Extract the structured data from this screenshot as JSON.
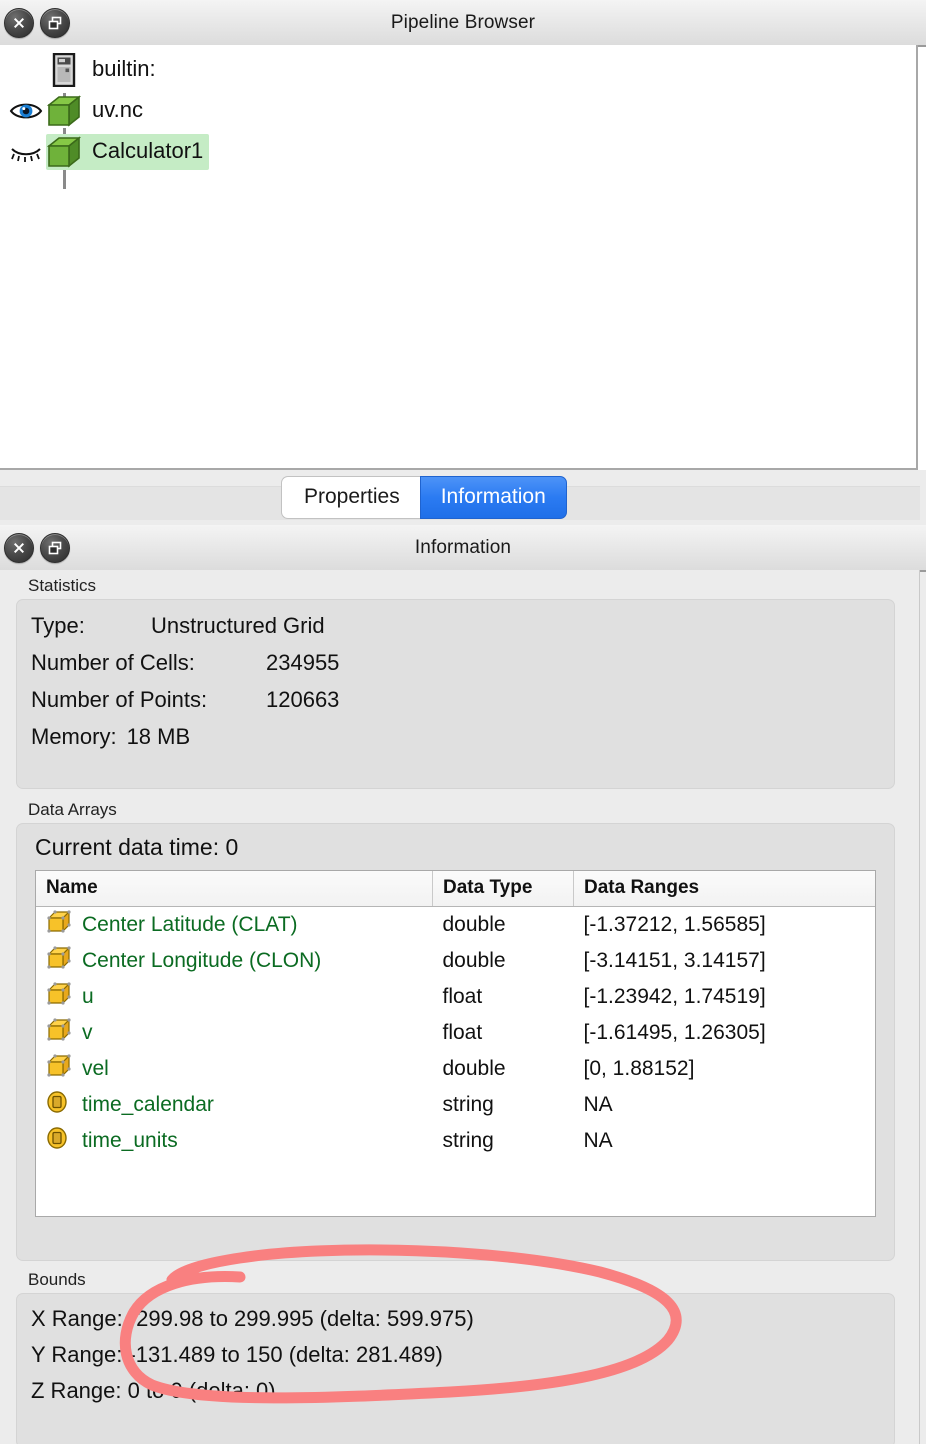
{
  "pipeline_browser": {
    "title": "Pipeline Browser",
    "close_label": "Close",
    "float_label": "Undock",
    "items": [
      {
        "label": "builtin:",
        "icon": "server-icon",
        "visibility": "none",
        "selected": false
      },
      {
        "label": "uv.nc",
        "icon": "source-cube-icon",
        "visibility": "visible",
        "selected": false
      },
      {
        "label": "Calculator1",
        "icon": "source-cube-icon",
        "visibility": "hidden",
        "selected": true
      }
    ]
  },
  "tabs": [
    {
      "label": "Properties",
      "active": false
    },
    {
      "label": "Information",
      "active": true
    }
  ],
  "information_panel": {
    "title": "Information",
    "close_label": "Close",
    "float_label": "Undock",
    "statistics": {
      "group_label": "Statistics",
      "rows": [
        {
          "key": "Type:",
          "value": "Unstructured Grid"
        },
        {
          "key": "Number of Cells:",
          "value": "234955"
        },
        {
          "key": "Number of Points:",
          "value": "120663"
        },
        {
          "key": "Memory:",
          "value": "18 MB"
        }
      ]
    },
    "data_arrays": {
      "group_label": "Data Arrays",
      "current_data_time": "Current data time: 0",
      "columns": [
        "Name",
        "Data Type",
        "Data Ranges"
      ],
      "rows": [
        {
          "icon": "cell-data-icon",
          "name": "Center Latitude (CLAT)",
          "type": "double",
          "range": "[-1.37212, 1.56585]"
        },
        {
          "icon": "cell-data-icon",
          "name": "Center Longitude (CLON)",
          "type": "double",
          "range": "[-3.14151, 3.14157]"
        },
        {
          "icon": "cell-data-icon",
          "name": "u",
          "type": "float",
          "range": "[-1.23942, 1.74519]"
        },
        {
          "icon": "cell-data-icon",
          "name": "v",
          "type": "float",
          "range": "[-1.61495, 1.26305]"
        },
        {
          "icon": "cell-data-icon",
          "name": "vel",
          "type": "double",
          "range": "[0, 1.88152]"
        },
        {
          "icon": "field-data-icon",
          "name": "time_calendar",
          "type": "string",
          "range": "NA"
        },
        {
          "icon": "field-data-icon",
          "name": "time_units",
          "type": "string",
          "range": "NA"
        }
      ]
    },
    "bounds": {
      "group_label": "Bounds",
      "rows": [
        {
          "key": "X Range:",
          "value": "-299.98 to 299.995 (delta: 599.975)"
        },
        {
          "key": "Y Range:",
          "value": "-131.489 to 150 (delta: 281.489)"
        },
        {
          "key": "Z Range:",
          "value": "0 to 0 (delta: 0)"
        }
      ]
    }
  },
  "annotation": {
    "shape": "hand-drawn-ellipse",
    "color": "#F98080",
    "targets": "X Range and Y Range bounds rows"
  },
  "colors": {
    "selection_highlight": "#c5ecc5",
    "active_tab": "#2b7bf2",
    "array_name_text": "#0b6b22",
    "annotation_red": "#F98080",
    "panel_background": "#ececec",
    "box_background": "#e0e0e0"
  }
}
